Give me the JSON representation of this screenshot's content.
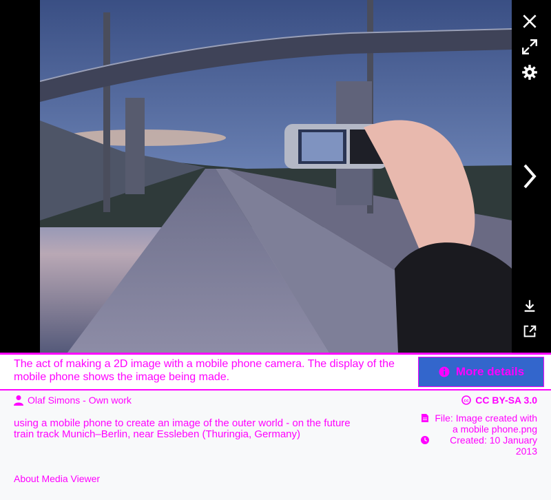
{
  "controls": {
    "close": "close-icon",
    "fullscreen": "fullscreen-icon",
    "settings": "gear-icon",
    "next": "chevron-right-icon",
    "download": "download-icon",
    "share": "share-icon"
  },
  "caption": "The act of making a 2D image with a mobile phone camera. The display of the mobile phone shows the image being made.",
  "more_details": "More details",
  "author": "Olaf Simons - Own work",
  "description": "using a mobile phone to create an image of the outer world - on the future train track Munich–Berlin, near Essleben (Thuringia, Germany)",
  "license": "CC BY-SA 3.0",
  "file": "File: Image created with a mobile phone.png",
  "created": "Created: 10 January 2013",
  "about": "About Media Viewer",
  "colors": {
    "accent": "#ff00ff",
    "button": "#3366cc",
    "viewer_bg": "#000000"
  }
}
